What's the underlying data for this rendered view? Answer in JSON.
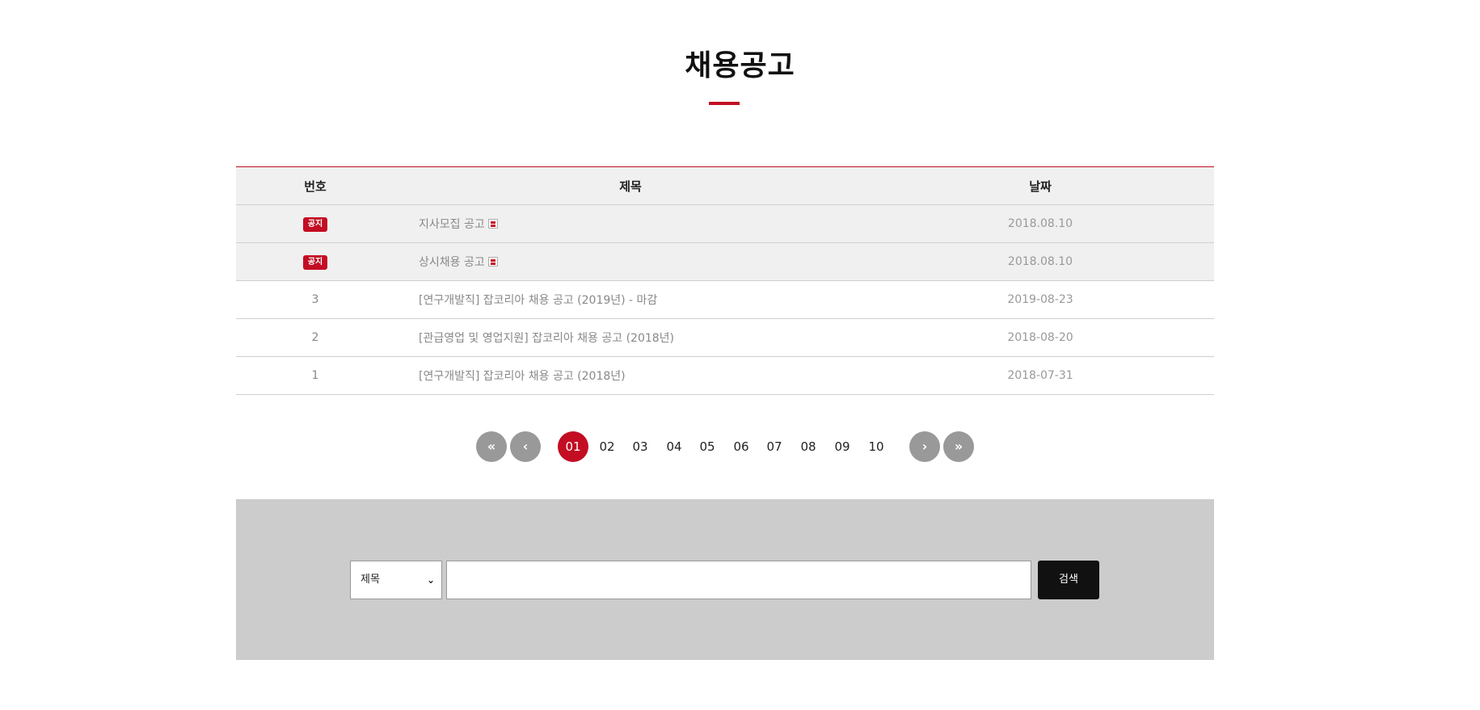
{
  "page": {
    "title": "채용공고"
  },
  "board": {
    "headers": {
      "no": "번호",
      "title": "제목",
      "date": "날짜"
    },
    "notices": [
      {
        "badge": "공지",
        "title": "지사모집 공고",
        "date": "2018.08.10",
        "has_attachment": true
      },
      {
        "badge": "공지",
        "title": "상시채용 공고",
        "date": "2018.08.10",
        "has_attachment": true
      }
    ],
    "rows": [
      {
        "no": "3",
        "title": "[연구개발직] 잡코리아 채용 공고 (2019년) - 마감",
        "date": "2019-08-23"
      },
      {
        "no": "2",
        "title": "[관급영업 및 영업지원] 잡코리아 채용 공고 (2018년)",
        "date": "2018-08-20"
      },
      {
        "no": "1",
        "title": "[연구개발직] 잡코리아 채용 공고 (2018년)",
        "date": "2018-07-31"
      }
    ]
  },
  "pagination": {
    "first": "«",
    "prev": "‹",
    "next": "›",
    "last": "»",
    "pages": [
      "01",
      "02",
      "03",
      "04",
      "05",
      "06",
      "07",
      "08",
      "09",
      "10"
    ],
    "current": "01"
  },
  "search": {
    "select_value": "제목",
    "input_value": "",
    "button_label": "검색"
  },
  "colors": {
    "accent": "#c30d23",
    "search_bg": "#cccccc"
  }
}
